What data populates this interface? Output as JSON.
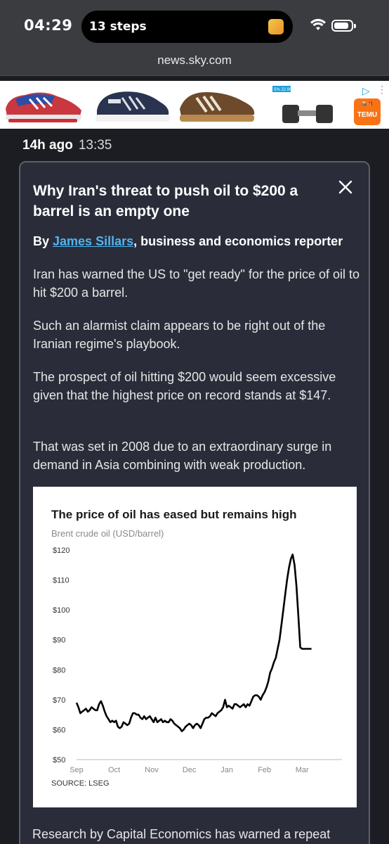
{
  "status": {
    "time": "04:29",
    "activity": "13 steps"
  },
  "browser": {
    "url": "news.sky.com"
  },
  "ad": {
    "brand": "TEMU",
    "brand_sub": "📦🎁",
    "dumbbell_tag": "5% 22.99"
  },
  "post": {
    "age": "14h ago",
    "time": "13:35"
  },
  "article": {
    "title": "Why Iran's threat to push oil to $200 a barrel is an empty one",
    "byline_prefix": "By ",
    "author": "James Sillars",
    "byline_suffix": ", business and economics reporter",
    "paragraphs": [
      "Iran has warned the US to \"get ready\" for the price of oil to hit $200 a barrel.",
      "Such an alarmist claim appears to be right out of the Iranian regime's playbook.",
      "The prospect of oil hitting $200 would seem excessive given that the highest price on record stands at $147.",
      "That was set in 2008 due to an extraordinary surge in demand in Asia combining with weak production."
    ],
    "tail": "Research by Capital Economics has warned a repeat"
  },
  "chart_data": {
    "type": "line",
    "title": "The price of oil has eased but remains high",
    "subtitle": "Brent crude oil (USD/barrel)",
    "source": "SOURCE: LSEG",
    "x_labels": [
      "Sep",
      "Oct",
      "Nov",
      "Dec",
      "Jan",
      "Feb",
      "Mar"
    ],
    "y_labels": [
      "$120",
      "$110",
      "$100",
      "$90",
      "$80",
      "$70",
      "$60",
      "$50"
    ],
    "ylim": [
      50,
      120
    ],
    "xlim": [
      0,
      6.5
    ],
    "grid": false,
    "series": [
      {
        "color": "#000000",
        "x": [
          0,
          0.05,
          0.1,
          0.15,
          0.2,
          0.25,
          0.3,
          0.35,
          0.4,
          0.45,
          0.5,
          0.55,
          0.6,
          0.65,
          0.7,
          0.75,
          0.8,
          0.85,
          0.9,
          0.95,
          1.0,
          1.05,
          1.1,
          1.15,
          1.2,
          1.25,
          1.3,
          1.35,
          1.4,
          1.45,
          1.5,
          1.55,
          1.6,
          1.65,
          1.7,
          1.75,
          1.8,
          1.85,
          1.9,
          1.95,
          2.0,
          2.05,
          2.1,
          2.15,
          2.2,
          2.25,
          2.3,
          2.35,
          2.4,
          2.45,
          2.5,
          2.55,
          2.6,
          2.65,
          2.7,
          2.75,
          2.8,
          2.85,
          2.9,
          2.95,
          3.0,
          3.05,
          3.1,
          3.15,
          3.2,
          3.25,
          3.3,
          3.35,
          3.4,
          3.45,
          3.5,
          3.55,
          3.6,
          3.65,
          3.7,
          3.75,
          3.8,
          3.85,
          3.9,
          3.95,
          4.0,
          4.05,
          4.1,
          4.15,
          4.2,
          4.25,
          4.3,
          4.35,
          4.4,
          4.45,
          4.5,
          4.55,
          4.6,
          4.65,
          4.7,
          4.75,
          4.8,
          4.85,
          4.9,
          4.95,
          5.0,
          5.05,
          5.1,
          5.15,
          5.2,
          5.25,
          5.3,
          5.35,
          5.4,
          5.45,
          5.5,
          5.55,
          5.6,
          5.65,
          5.7,
          5.75,
          5.8,
          5.85,
          5.9,
          5.95,
          6.0,
          6.05,
          6.1,
          6.15,
          6.2,
          6.25
        ],
        "y": [
          69,
          67.5,
          65.5,
          66,
          66.5,
          67,
          66,
          66.5,
          67.5,
          67,
          66.5,
          66.5,
          68.5,
          69.5,
          68,
          66,
          64.5,
          63.5,
          62.5,
          63,
          62.5,
          63,
          61,
          60.5,
          61,
          62.5,
          62,
          61.5,
          62,
          64,
          65.5,
          65.5,
          65,
          65,
          64,
          63.5,
          64.5,
          63.5,
          64,
          64.5,
          63.5,
          62.5,
          64,
          62.5,
          63,
          63.5,
          62.5,
          63,
          62.5,
          62.5,
          63.5,
          63,
          62,
          61.5,
          61,
          60.5,
          59.5,
          60,
          61,
          61.5,
          62,
          61.5,
          60.5,
          61.5,
          62,
          61.5,
          60.5,
          62,
          63.5,
          64,
          64,
          64.5,
          65.5,
          65,
          64.5,
          65.5,
          66,
          66.5,
          67.5,
          70,
          67.5,
          68,
          67.5,
          67,
          68.5,
          68.5,
          68,
          67.5,
          68,
          68.5,
          67.5,
          68.5,
          68,
          69.5,
          71,
          71.5,
          71.5,
          71,
          70,
          71.5,
          72.5,
          74,
          76,
          79,
          80.5,
          82.5,
          84,
          87,
          90,
          95,
          100,
          105,
          110,
          114,
          117,
          118.5,
          115,
          108,
          98,
          87.5,
          87,
          87,
          87,
          87,
          87,
          87
        ]
      }
    ]
  }
}
